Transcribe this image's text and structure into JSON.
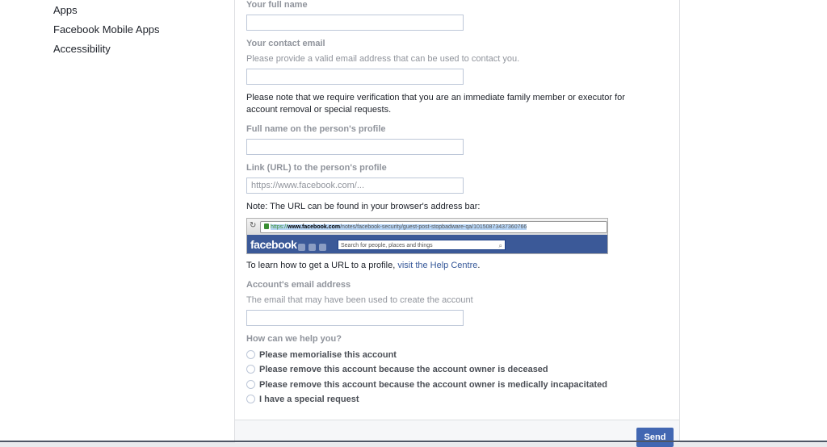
{
  "left_nav": {
    "items": [
      "Apps",
      "Facebook Mobile Apps",
      "Accessibility"
    ]
  },
  "form": {
    "your_full_name_label": "Your full name",
    "contact_email_label": "Your contact email",
    "contact_email_help": "Please provide a valid email address that can be used to contact you.",
    "verification_note": "Please note that we require verification that you are an immediate family member or executor for account removal or special requests.",
    "profile_name_label": "Full name on the person's profile",
    "profile_url_label": "Link (URL) to the person's profile",
    "profile_url_placeholder": "https://www.facebook.com/...",
    "url_note": "Note: The URL can be found in your browser's address bar:",
    "browser_example": {
      "url_https": "https://",
      "url_domain": "www.facebook.com",
      "url_path": "/notes/facebook-security/guest-post-stopbadware-qa/10150873437360766",
      "logo": "facebook",
      "search_placeholder": "Search for people, places and things"
    },
    "help_text_prefix": "To learn how to get a URL to a profile,",
    "help_link": "visit the Help Centre",
    "help_text_suffix": ".",
    "account_email_label": "Account's email address",
    "account_email_help": "The email that may have been used to create the account",
    "help_question": "How can we help you?",
    "options": [
      "Please memorialise this account",
      "Please remove this account because the account owner is deceased",
      "Please remove this account because the account owner is medically incapacitated",
      "I have a special request"
    ]
  },
  "footer": {
    "send_label": "Send"
  }
}
